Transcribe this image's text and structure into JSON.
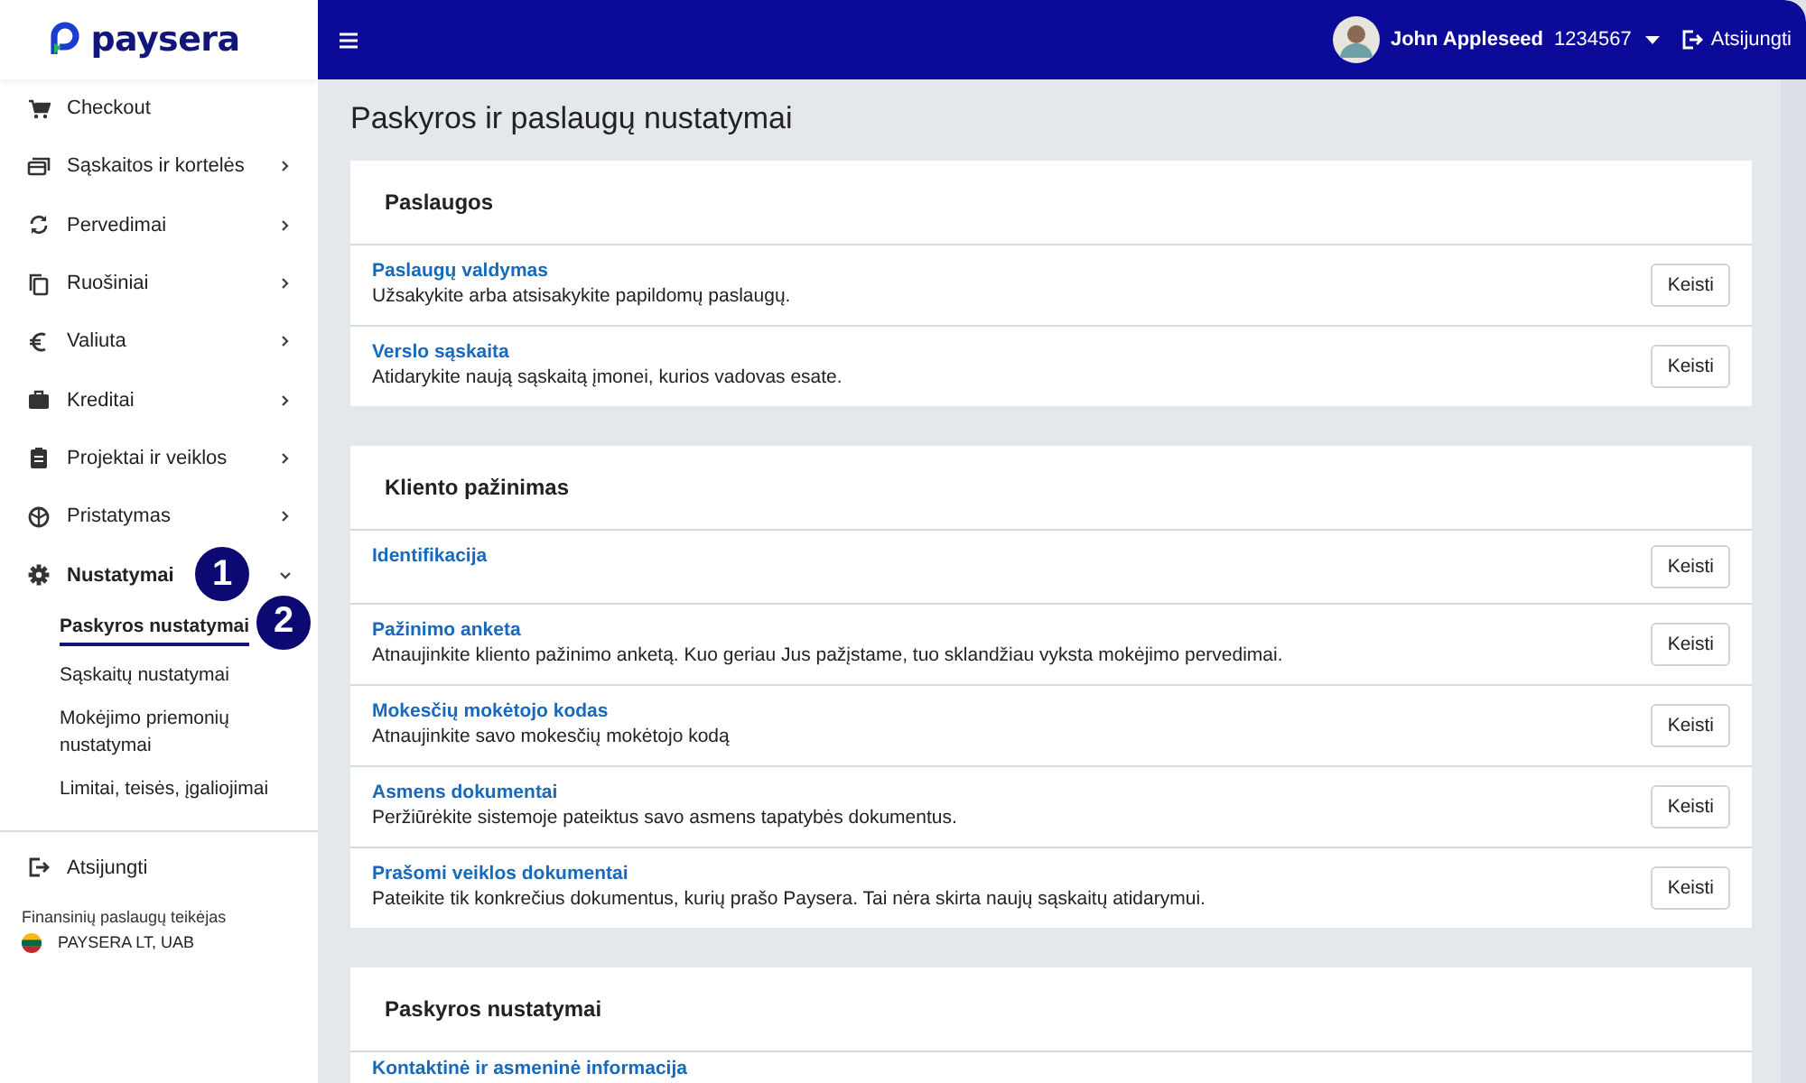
{
  "logo": {
    "text": "paysera"
  },
  "sidebar": {
    "items": [
      {
        "label": "Checkout",
        "selected": false
      },
      {
        "label": "Sąskaitos ir kortelės",
        "selected": false,
        "expanded": false
      },
      {
        "label": "Pervedimai",
        "selected": false,
        "expanded": false
      },
      {
        "label": "Ruošiniai",
        "selected": false,
        "expanded": false
      },
      {
        "label": "Valiuta",
        "selected": false,
        "expanded": false
      },
      {
        "label": "Kreditai",
        "selected": false,
        "expanded": false
      },
      {
        "label": "Projektai ir veiklos",
        "selected": false,
        "expanded": false
      },
      {
        "label": "Pristatymas",
        "selected": false,
        "expanded": false
      },
      {
        "label": "Nustatymai",
        "selected": true,
        "expanded": true,
        "callout": "1",
        "children": [
          {
            "label": "Paskyros nustatymai",
            "selected": true,
            "callout": "2"
          },
          {
            "label": "Sąskaitų nustatymai",
            "selected": false
          },
          {
            "label": "Mokėjimo priemonių nustatymai",
            "selected": false
          },
          {
            "label": "Limitai, teisės, įgaliojimai",
            "selected": false
          }
        ]
      }
    ],
    "logout": "Atsijungti",
    "provider_label": "Finansinių paslaugų teikėjas",
    "provider_name": "PAYSERA LT, UAB"
  },
  "header": {
    "user_name": "John Appleseed",
    "user_id": "1234567",
    "logout": "Atsijungti"
  },
  "page_title": "Paskyros ir paslaugų nustatymai",
  "sections": [
    {
      "title": "Paslaugos",
      "rows": [
        {
          "title": "Paslaugų valdymas",
          "description": "Užsakykite arba atsisakykite papildomų paslaugų.",
          "button": "Keisti"
        },
        {
          "title": "Verslo sąskaita",
          "description": "Atidarykite naują sąskaitą įmonei, kurios vadovas esate.",
          "button": "Keisti"
        }
      ]
    },
    {
      "title": "Kliento pažinimas",
      "rows": [
        {
          "title": "Identifikacija",
          "button": "Keisti"
        },
        {
          "title": "Pažinimo anketa",
          "description": "Atnaujinkite kliento pažinimo anketą. Kuo geriau Jus pažįstame, tuo sklandžiau vyksta mokėjimo pervedimai.",
          "button": "Keisti"
        },
        {
          "title": "Mokesčių mokėtojo kodas",
          "description": "Atnaujinkite savo mokesčių mokėtojo kodą",
          "button": "Keisti"
        },
        {
          "title": "Asmens dokumentai",
          "description": "Peržiūrėkite sistemoje pateiktus savo asmens tapatybės dokumentus.",
          "button": "Keisti"
        },
        {
          "title": "Prašomi veiklos dokumentai",
          "description": "Pateikite tik konkrečius dokumentus, kurių prašo Paysera. Tai nėra skirta naujų sąskaitų atidarymui.",
          "button": "Keisti"
        }
      ]
    },
    {
      "title": "Paskyros nustatymai",
      "rows": [
        {
          "title": "Kontaktinė ir asmeninė informacija"
        }
      ]
    }
  ]
}
